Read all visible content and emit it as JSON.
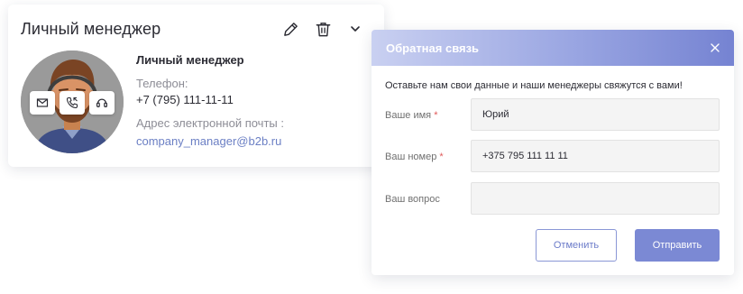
{
  "manager_card": {
    "title": "Личный менеджер",
    "name_heading": "Личный менеджер",
    "phone_label": "Телефон:",
    "phone": "+7 (795) 111-11-11",
    "email_label": "Адрес электронной почты :",
    "email": "company_manager@b2b.ru",
    "toolbar_icons": [
      "pencil-icon",
      "trash-icon",
      "chevron-down-icon"
    ],
    "contact_icons": [
      "mail-icon",
      "phone-icon",
      "headset-icon"
    ]
  },
  "feedback_modal": {
    "title": "Обратная связь",
    "intro": "Оставьте нам свои данные и наши менеджеры свяжутся с вами!",
    "fields": {
      "name": {
        "label": "Ваше имя",
        "required_mark": "*",
        "value": "Юрий"
      },
      "phone": {
        "label": "Ваш номер",
        "required_mark": "*",
        "value": "+375 795 111 11 11"
      },
      "question": {
        "label": "Ваш вопрос",
        "value": ""
      }
    },
    "cancel_label": "Отменить",
    "submit_label": "Отправить"
  },
  "colors": {
    "accent": "#7b89d4",
    "link": "#6b7fc4",
    "required": "#e05a5a",
    "text": "#2b2b33"
  }
}
